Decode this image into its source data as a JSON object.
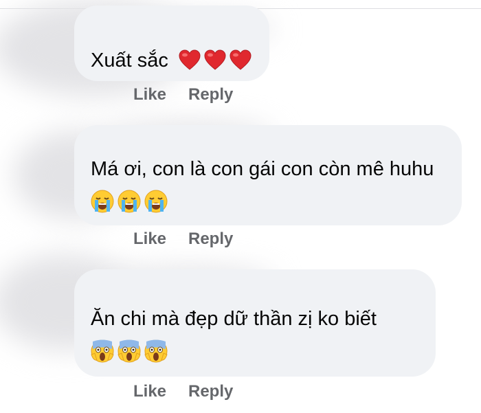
{
  "comments": [
    {
      "text": "Xuất sắc",
      "emoji": [
        "heart-icon",
        "heart-icon",
        "heart-icon"
      ],
      "like": "Like",
      "reply": "Reply"
    },
    {
      "text": "Má ơi, con là con gái con còn mê huhu",
      "emoji": [
        "loudly-crying-face-icon",
        "loudly-crying-face-icon",
        "loudly-crying-face-icon"
      ],
      "like": "Like",
      "reply": "Reply"
    },
    {
      "text": "Ăn chi mà đẹp dữ thần zị ko biết",
      "emoji": [
        "screaming-face-icon",
        "screaming-face-icon",
        "screaming-face-icon"
      ],
      "like": "Like",
      "reply": "Reply"
    }
  ],
  "colors": {
    "bubble": "#f0f2f5",
    "action_text": "#65676b",
    "heart": "#e0282e",
    "face": "#ffcc33"
  }
}
